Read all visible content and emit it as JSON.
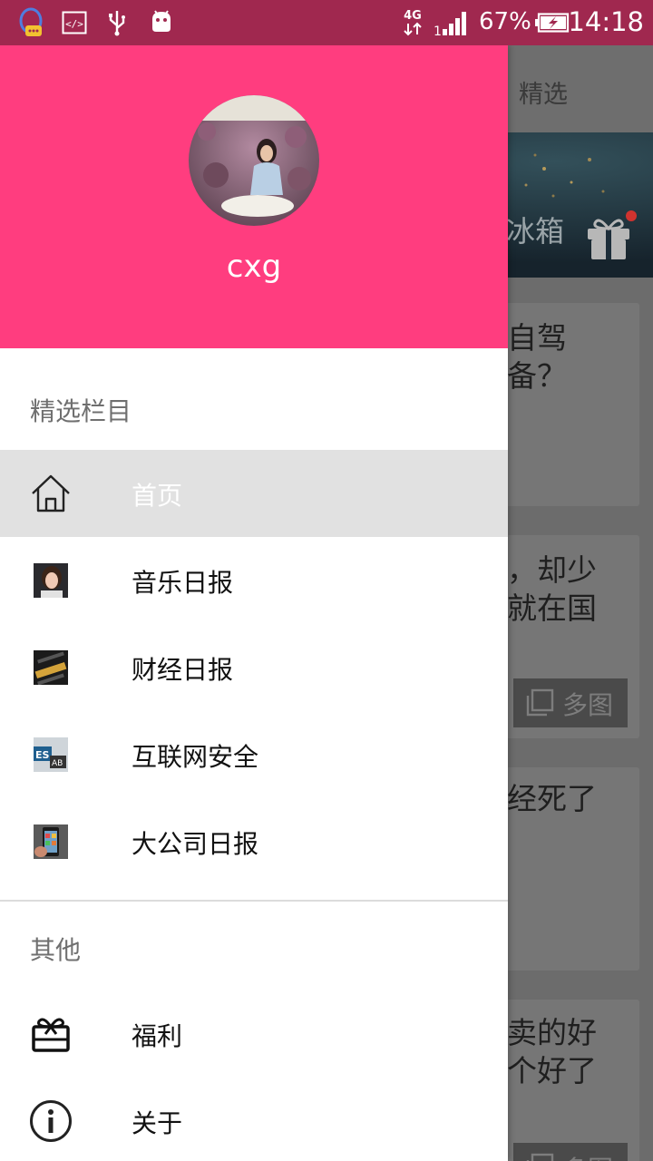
{
  "status_bar": {
    "icons": [
      "qq-icon",
      "code-icon",
      "usb-icon",
      "android-icon",
      "network-4g-icon",
      "signal-icon",
      "battery-charging-icon"
    ],
    "network": "4G",
    "battery": "67%",
    "time": "14:18"
  },
  "background": {
    "tab": "精选",
    "banner_text": "冰箱",
    "cards": [
      {
        "text": "自驾\n备？"
      },
      {
        "text": "，却少\n就在国",
        "badge": "多图"
      },
      {
        "text": "经死了"
      },
      {
        "text": "卖的好\n个好了",
        "badge": "多图"
      }
    ]
  },
  "drawer": {
    "username": "cxg",
    "sections": [
      {
        "title": "精选栏目",
        "items": [
          {
            "label": "首页",
            "icon": "home-icon",
            "active": true
          },
          {
            "label": "音乐日报",
            "icon": "music-daily-thumbnail",
            "active": false
          },
          {
            "label": "财经日报",
            "icon": "finance-daily-thumbnail",
            "active": false
          },
          {
            "label": "互联网安全",
            "icon": "internet-security-thumbnail",
            "active": false
          },
          {
            "label": "大公司日报",
            "icon": "big-company-thumbnail",
            "active": false
          }
        ]
      },
      {
        "title": "其他",
        "items": [
          {
            "label": "福利",
            "icon": "gift-icon",
            "active": false
          },
          {
            "label": "关于",
            "icon": "info-icon",
            "active": false
          }
        ]
      }
    ]
  },
  "colors": {
    "header": "#ff3d7f",
    "status_bar": "#a0284f",
    "active_item": "#e1e1e1",
    "scrim": "#6c6c6c"
  }
}
